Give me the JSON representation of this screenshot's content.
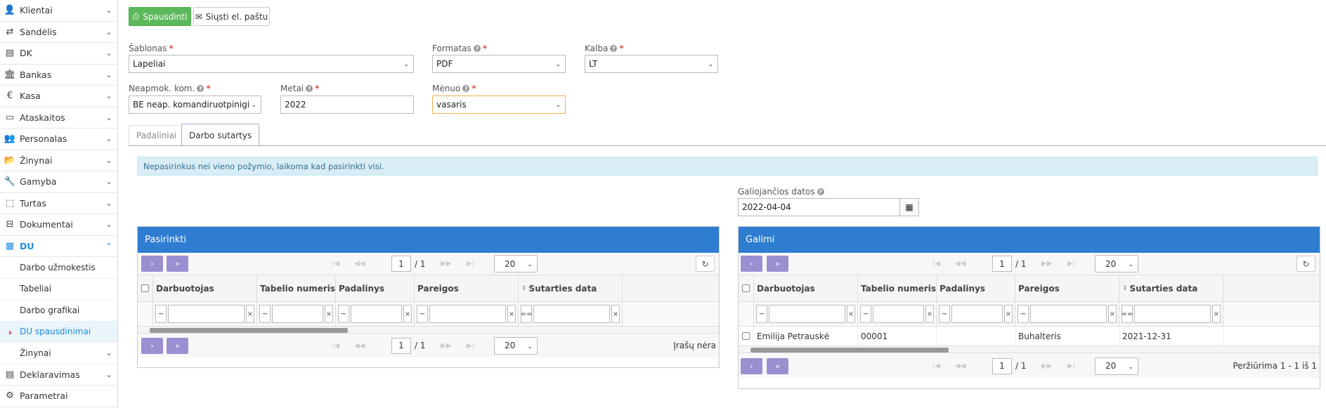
{
  "sidebar": {
    "items": [
      {
        "label": "Klientai",
        "icon": "user-icon",
        "glyph": "👤",
        "chevron": "⌄"
      },
      {
        "label": "Sandėlis",
        "icon": "exchange-icon",
        "glyph": "⇄",
        "chevron": "⌄"
      },
      {
        "label": "DK",
        "icon": "book-icon",
        "glyph": "▤",
        "chevron": "⌄"
      },
      {
        "label": "Bankas",
        "icon": "bank-icon",
        "glyph": "🏛",
        "chevron": "⌄"
      },
      {
        "label": "Kasa",
        "icon": "euro-icon",
        "glyph": "€",
        "chevron": "⌄"
      },
      {
        "label": "Ataskaitos",
        "icon": "file-icon",
        "glyph": "▭",
        "chevron": "⌄"
      },
      {
        "label": "Personalas",
        "icon": "users-icon",
        "glyph": "👥",
        "chevron": "⌄"
      },
      {
        "label": "Žinynai",
        "icon": "folder-open-icon",
        "glyph": "📂",
        "chevron": "⌄"
      },
      {
        "label": "Gamyba",
        "icon": "wrench-icon",
        "glyph": "🔧",
        "chevron": "⌄"
      },
      {
        "label": "Turtas",
        "icon": "cube-icon",
        "glyph": "⬚",
        "chevron": "⌄"
      },
      {
        "label": "Dokumentai",
        "icon": "inbox-icon",
        "glyph": "⊟",
        "chevron": "⌄"
      },
      {
        "label": "DU",
        "icon": "table-icon",
        "glyph": "▦",
        "chevron": "⌃"
      }
    ],
    "sub_items": [
      {
        "label": "Darbo užmokestis"
      },
      {
        "label": "Tabeliai"
      },
      {
        "label": "Darbo grafikai"
      },
      {
        "label": "DU spausdinimai"
      },
      {
        "label": "Žinynai",
        "chevron": "⌄"
      }
    ],
    "bottom_items": [
      {
        "label": "Deklaravimas",
        "icon": "file-text-icon",
        "glyph": "▤",
        "chevron": "⌄"
      },
      {
        "label": "Parametrai",
        "icon": "cogs-icon",
        "glyph": "⚙",
        "chevron": ""
      }
    ]
  },
  "toolbar": {
    "print_label": "Spausdinti",
    "email_label": "Siųsti el. paštu"
  },
  "form": {
    "sablonas_label": "Šablonas",
    "sablonas_value": "Lapeliai",
    "formatas_label": "Formatas",
    "formatas_value": "PDF",
    "kalba_label": "Kalba",
    "kalba_value": "LT",
    "neapmok_label": "Neapmok. kom.",
    "neapmok_value": "BE neap. komandiruotpinigių",
    "metai_label": "Metai",
    "metai_value": "2022",
    "menuo_label": "Mėnuo",
    "menuo_value": "vasaris",
    "required_mark": "*",
    "help_mark": "?",
    "arrow": "⌄"
  },
  "tabs": [
    {
      "label": "Padaliniai"
    },
    {
      "label": "Darbo sutartys"
    }
  ],
  "alert_text": "Nepasirinkus nei vieno požymio, laikoma kad pasirinkti visi.",
  "validity": {
    "label": "Galiojančios datos",
    "value": "2022-04-04"
  },
  "left_panel": {
    "title": "Pasirinkti",
    "page": "1",
    "page_total": "/ 1",
    "page_size": "20",
    "footer_text": "Įrašų nėra",
    "columns": [
      "Darbuotojas",
      "Tabelio numeris",
      "Padalinys",
      "Pareigos",
      "Sutarties data"
    ],
    "filter_ops": [
      "~",
      "~",
      "~",
      "~",
      "=="
    ]
  },
  "right_panel": {
    "title": "Galimi",
    "page": "1",
    "page_total": "/ 1",
    "page_size": "20",
    "footer_text": "Peržiūrima 1 - 1 iš 1",
    "columns": [
      "Darbuotojas",
      "Tabelio numeris",
      "Padalinys",
      "Pareigos",
      "Sutarties data"
    ],
    "filter_ops": [
      "~",
      "~",
      "~",
      "~",
      "=="
    ],
    "rows": [
      {
        "darbuotojas": "Emilija Petrauskė",
        "tabelio": "00001",
        "padalinys": "",
        "pareigos": "Buhalteris",
        "data": "2021-12-31"
      }
    ]
  },
  "glyphs": {
    "next": "›",
    "last": "»",
    "prev": "‹",
    "first": "«",
    "clear": "×",
    "refresh": "↻",
    "sort": "⇕",
    "calendar": "▦",
    "pg_first": "|◀",
    "pg_prev": "◀◀",
    "pg_next": "▶▶",
    "pg_last": "▶|"
  },
  "colors": {
    "accent": "#2e7dd0",
    "pager_button": "#9b8fd1",
    "print_button": "#5cb85c",
    "active_nav": "#1e8dd6",
    "required": "#d9534f"
  }
}
